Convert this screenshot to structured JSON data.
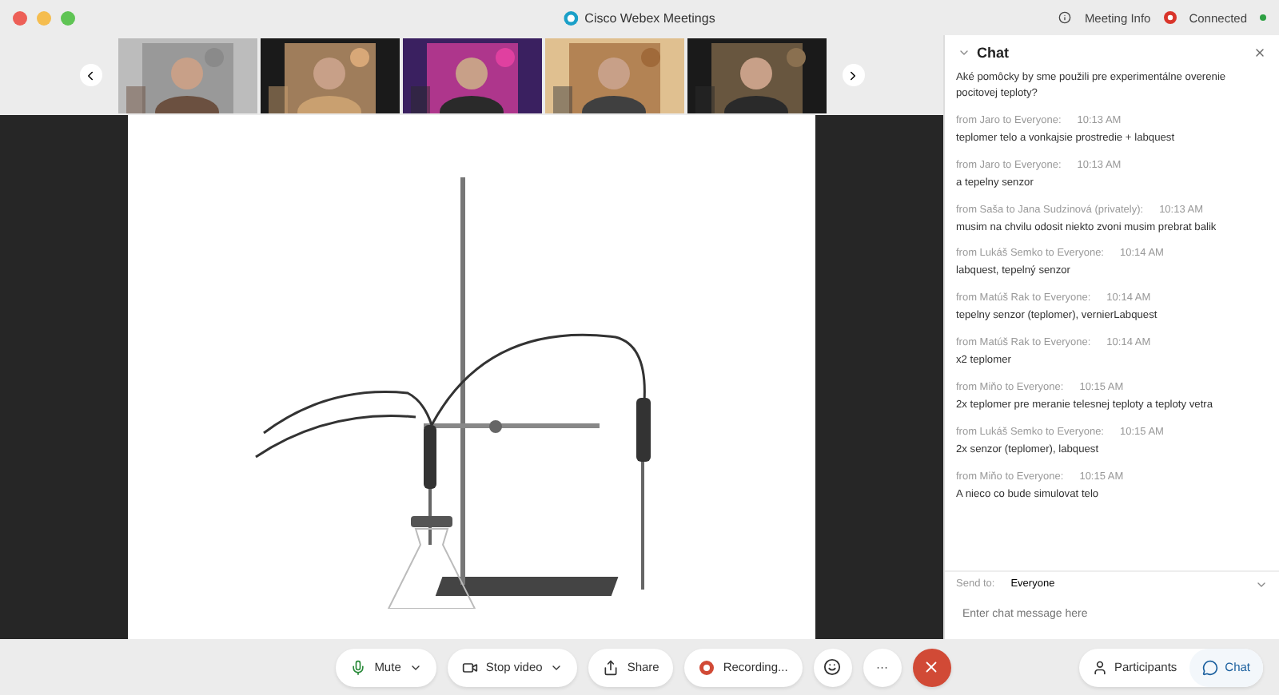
{
  "window": {
    "title": "Cisco Webex Meetings",
    "meeting_info": "Meeting Info",
    "status": "Connected"
  },
  "chat": {
    "title": "Chat",
    "messages": [
      {
        "text": "Aké pomôcky by sme použili pre experimentálne overenie pocitovej teploty?"
      },
      {
        "sender": "from Jaro to Everyone:",
        "time": "10:13  AM",
        "text": "teplomer telo a vonkajsie prostredie + labquest"
      },
      {
        "sender": "from Jaro to Everyone:",
        "time": "10:13  AM",
        "text": "a tepelny senzor"
      },
      {
        "sender": "from Saša to Jana Sudzinová (privately):",
        "time": "10:13  AM",
        "text": "musim na chvilu odosit niekto zvoni musim prebrat balik"
      },
      {
        "sender": "from Lukáš Semko to Everyone:",
        "time": "10:14  AM",
        "text": "labquest, tepelný senzor"
      },
      {
        "sender": "from Matúš Rak to Everyone:",
        "time": "10:14  AM",
        "text": "tepelny senzor (teplomer), vernierLabquest"
      },
      {
        "sender": "from Matúš Rak to Everyone:",
        "time": "10:14  AM",
        "text": "x2 teplomer"
      },
      {
        "sender": "from Miňo to Everyone:",
        "time": "10:15  AM",
        "text": "2x teplomer pre meranie telesnej teploty a teploty vetra"
      },
      {
        "sender": "from Lukáš Semko to Everyone:",
        "time": "10:15  AM",
        "text": "2x senzor (teplomer), labquest"
      },
      {
        "sender": "from Miňo to Everyone:",
        "time": "10:15  AM",
        "text": "A nieco co bude simulovat telo"
      }
    ],
    "send_to_label": "Send to:",
    "send_to": "Everyone",
    "placeholder": "Enter chat message here"
  },
  "toolbar": {
    "buttons": [
      {
        "kind": "mute",
        "label": "Mute"
      },
      {
        "kind": "video",
        "label": "Stop video"
      },
      {
        "kind": "share",
        "label": "Share"
      },
      {
        "kind": "record",
        "label": "Recording..."
      },
      {
        "kind": "emoji"
      },
      {
        "kind": "more",
        "label": "···"
      },
      {
        "kind": "leave"
      }
    ],
    "right": [
      {
        "kind": "participants",
        "label": "Participants",
        "selected": false
      },
      {
        "kind": "chat",
        "label": "Chat",
        "selected": true
      }
    ]
  }
}
